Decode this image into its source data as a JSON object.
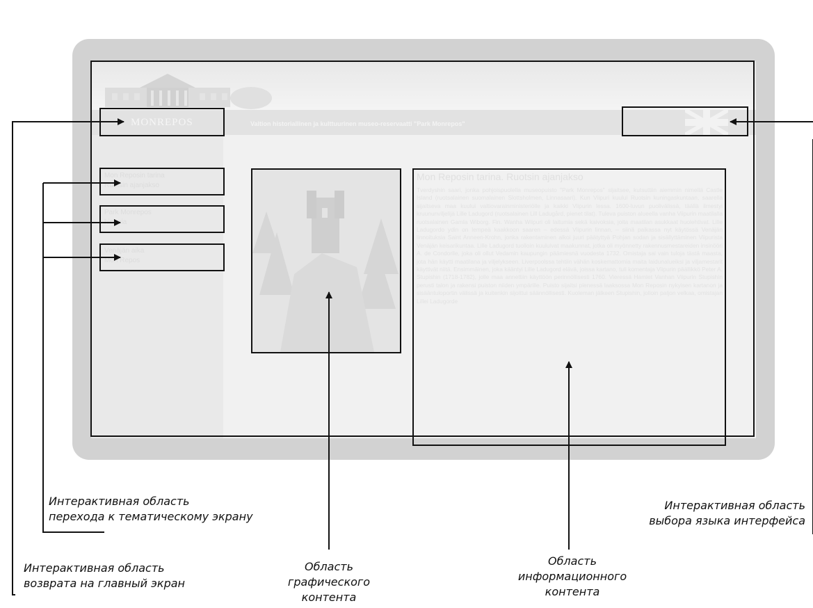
{
  "screen": {
    "logo": "MONREPOS",
    "header_subtitle": "Valtion historiallinen ja kulttuurinen museo-reservaatti \"Park Monrepos\"",
    "nav_items": [
      {
        "line1": "Mon Reposin tarina",
        "line2": "Ruotsin ajanjakso"
      },
      {
        "line1": "Park Monrepos",
        "line2": "historia"
      },
      {
        "line1": "Venäjän aika",
        "line2": "Mon Repos"
      }
    ],
    "article_title": "Mon Reposin tarina. Ruotsin ajanjakso",
    "article_body": "Tverdyshin saari, jonka pohjoispuolella museopuisto \"Park Monrepos\" sijaitsee, kutsuttiin aiemmin nimellä Castle Island (ruotsalainen suomalainen Slottsholmen, Linnasaari). Kun Viipuri kuului Ruotsin kuningaskuntaan, saarella sijaitseva maa kuului valtiovarainministeriölle ja kaikki Viipurin lessa. 1600-luvun puolivälissä, täällä ilmestyi kruununviljelijä Lille Ladugord (ruotsalainen Lill Ladugård, pienet tilat). Tuleva puiston alueella vanha Viipurin maatilalla ruotsalainen Gamla Wiborg. Fin. Wanha Wiipuri oli laitumia sekä kaivoksia, joita maatilan asukkaat huolehtivat. Lille Ladugordo ydin on lempeä kaakkoon saaren – edessä Viipurin linnan, – siinä paikassa nyt käytössä Venäjän linnoituksia Saint Anneen-Krohn, jonka rakentaminen alkoi juuri päätyttyä Pohjan sodan ja sisällyttäminen Viipurista Venäjän keisarikuntaa. Lille Ladugord tuolloin kuuluivat maakunnat, jotka oli myönnetty rakennusmestareiden insinööri A. de Condorlle, joka oli ollut Vedamin kaupungin päämiesnä vuodesta 1732. Omistaja sai vain tuloja tästä maasta, jota hän käytti maatilana ja viljelykseen. Liverpoolssa tehtiin vähän koskemattomia maita laidunalueiksi ja viljamestarit käyttivät niitä. Ensimmäinen, joka kääntyi Lille Ladugord elävä, joissa kartano, tuli komentaja Viipurin päällikkö Peter A. Stupishin (1718-1782), jolle maa annettiin käyttöön perinnöllisesti 1760. Vieressä Hamlet Vanhan Viipurin Stupishin perusti talon ja rakensi puiston niiden ympärille. Puisto sijaitsi pienessä laaksossa Mon Reposin nykyisen kartanon ja sisääntuloportin välissä ja kuitenkin sijoittui säännöllisesti. Kuoleman jälkeen Stupishin, jolloin paljon velkaa, omistajan Lillei Ladugorde",
    "background": "#f1f1f1",
    "frame_color": "#d2d2d2"
  },
  "annotations": {
    "nav_area": {
      "line1": "Интерактивная область",
      "line2": "перехода к тематическому экрану"
    },
    "language_area": {
      "line1": "Интерактивная область",
      "line2": "выбора языка интерфейса"
    },
    "home_area": {
      "line1": "Интерактивная область",
      "line2": "возврата на главный экран"
    },
    "graphic_area": {
      "line1": "Область",
      "line2": "графического",
      "line3": "контента"
    },
    "info_area": {
      "line1": "Область",
      "line2": "информационного",
      "line3": "контента"
    }
  },
  "icons": {
    "language_flag": "uk-flag-icon",
    "mansion_image": "mansion-image",
    "castle_image": "castle-on-rock-image"
  }
}
